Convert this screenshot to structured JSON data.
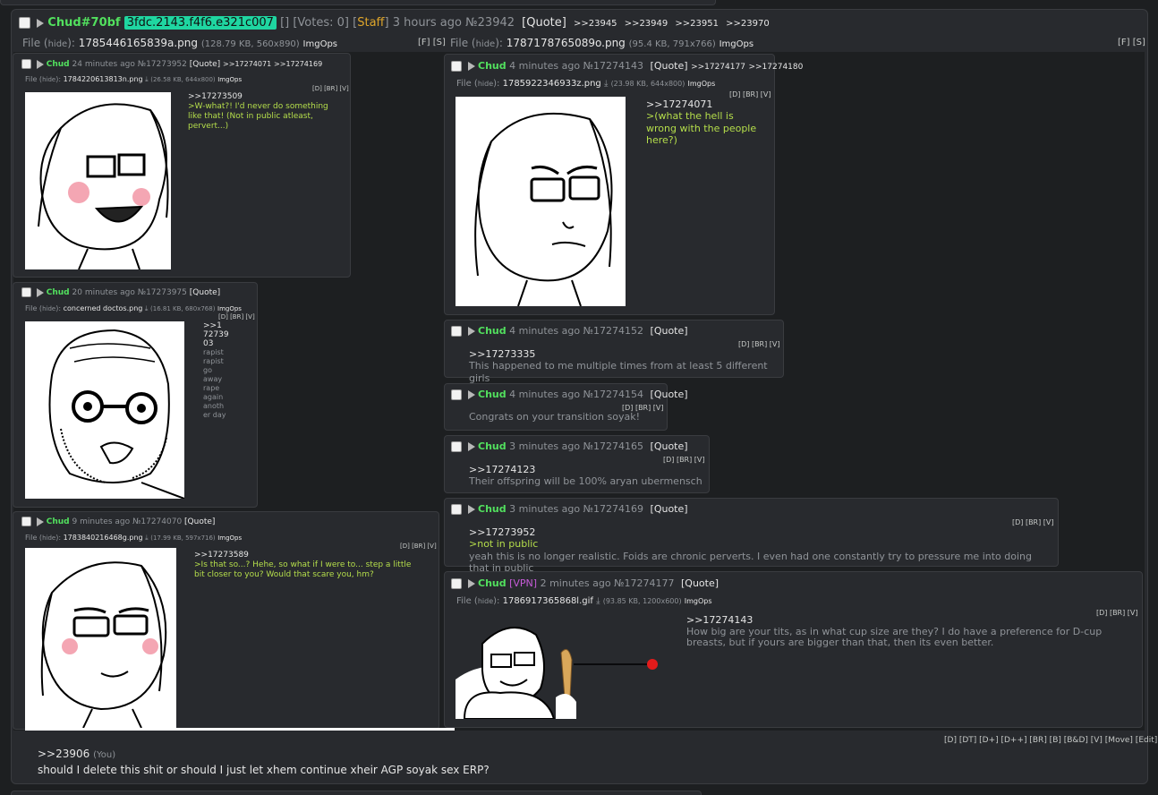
{
  "thread": {
    "name": "Chud",
    "id_hash": "#70bf",
    "id_badge": "3fdc.2143.f4f6.e321c007",
    "votes": "[] [Votes: 0]",
    "role_open": "[",
    "role": "Staff",
    "role_close": "]",
    "time": "3 hours ago",
    "no": "№23942",
    "quote": "[Quote]",
    "replies": [
      ">>23945",
      ">>23949",
      ">>23951",
      ">>23970"
    ],
    "file1": {
      "prefix": "File (",
      "hide": "hide",
      "suffix": "):",
      "name": "1785446165839a.png",
      "meta": "(128.79 KB, 560x890)",
      "imgops": "ImgOps",
      "ctrl": "[F] [S]"
    },
    "file2": {
      "prefix": "File (",
      "hide": "hide",
      "suffix": "):",
      "name": "1787178765089o.png",
      "meta": "(95.4 KB, 791x766)",
      "imgops": "ImgOps",
      "ctrl": "[F] [S]"
    }
  },
  "left_posts": [
    {
      "name": "Chud",
      "time": "24 minutes ago",
      "no": "№17273952",
      "quote": "[Quote]",
      "replies": [
        ">>17274071",
        ">>17274169"
      ],
      "file_prefix": "File (",
      "hide": "hide",
      "file_suffix": "):",
      "filename": "1784220613813n.png",
      "filemeta": "(26.58 KB, 644x800)",
      "imgops": "ImgOps",
      "controls": "[D] [BR] [V]",
      "ref": ">>17273509",
      "body": ">W-what?! I'd never do something like that! (Not in public atleast, pervert...)"
    },
    {
      "name": "Chud",
      "time": "20 minutes ago",
      "no": "№17273975",
      "quote": "[Quote]",
      "file_prefix": "File (",
      "hide": "hide",
      "file_suffix": "):",
      "filename": "concerned doctos.png",
      "filemeta": "(16.81 KB, 680x768)",
      "imgops": "ImgOps",
      "controls": "[D] [BR] [V]",
      "ref_lines": [
        ">>1",
        "72739",
        "03"
      ],
      "body_lines": [
        "rapist",
        "rapist",
        "go",
        "away",
        "rape",
        "again",
        "anoth",
        "er day"
      ]
    },
    {
      "name": "Chud",
      "time": "9 minutes ago",
      "no": "№17274070",
      "quote": "[Quote]",
      "file_prefix": "File (",
      "hide": "hide",
      "file_suffix": "):",
      "filename": "1783840216468g.png",
      "filemeta": "(17.99 KB, 597x716)",
      "imgops": "ImgOps",
      "controls": "[D] [BR] [V]",
      "ref": ">>17273589",
      "body": ">Is that so...? Hehe, so what if I were to... step a little bit closer to you? Would that scare you, hm?"
    }
  ],
  "right_posts": [
    {
      "name": "Chud",
      "time": "4 minutes ago",
      "no": "№17274143",
      "quote": "[Quote]",
      "replies": [
        ">>17274177",
        ">>17274180"
      ],
      "file_prefix": "File (",
      "hide": "hide",
      "file_suffix": "):",
      "filename": "1785922346933z.png",
      "filemeta": "(23.98 KB, 644x800)",
      "imgops": "ImgOps",
      "controls": "[D] [BR] [V]",
      "ref": ">>17274071",
      "body": ">(what the hell is wrong with the people here?)"
    },
    {
      "name": "Chud",
      "time": "4 minutes ago",
      "no": "№17274152",
      "quote": "[Quote]",
      "controls": "[D] [BR] [V]",
      "ref": ">>17273335",
      "body": "This happened to me multiple times from at least 5 different girls"
    },
    {
      "name": "Chud",
      "time": "4 minutes ago",
      "no": "№17274154",
      "quote": "[Quote]",
      "controls": "[D] [BR] [V]",
      "body": "Congrats on your transition soyak!"
    },
    {
      "name": "Chud",
      "time": "3 minutes ago",
      "no": "№17274165",
      "quote": "[Quote]",
      "controls": "[D] [BR] [V]",
      "ref": ">>17274123",
      "body": "Their offspring will be 100% aryan ubermensch"
    },
    {
      "name": "Chud",
      "time": "3 minutes ago",
      "no": "№17274169",
      "quote": "[Quote]",
      "controls": "[D] [BR] [V]",
      "ref": ">>17273952",
      "green": ">not in public",
      "body": "yeah this is no longer realistic. Foids are chronic perverts. I even had one constantly try to pressure me into doing that in public"
    },
    {
      "name": "Chud",
      "flag": "[VPN]",
      "time": "2 minutes ago",
      "no": "№17274177",
      "quote": "[Quote]",
      "file_prefix": "File (",
      "hide": "hide",
      "file_suffix": "):",
      "filename": "1786917365868l.gif",
      "filemeta": "(93.85 KB, 1200x600)",
      "imgops": "ImgOps",
      "controls": "[D] [BR] [V]",
      "ref": ">>17274143",
      "body": "How big are your tits, as in what cup size are they? I do have a preference for D-cup breasts, but if yours are bigger than that, then its even better."
    }
  ],
  "footer": {
    "controls": "[D] [DT] [D+] [D++] [BR] [B] [B&D] [V] [Move] [Edit]",
    "ref": ">>23906",
    "you": "(You)",
    "message": "should I delete this shit or should I just let xhem continue xheir AGP soyak sex ERP?"
  }
}
